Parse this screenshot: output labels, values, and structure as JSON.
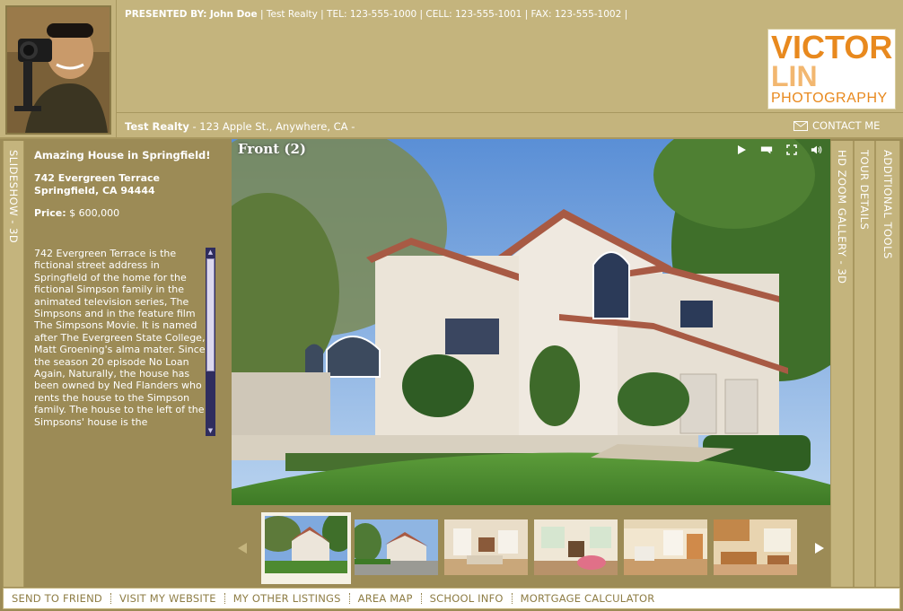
{
  "header": {
    "presented_label": "PRESENTED BY:",
    "agent_name": "John Doe",
    "contact_rest": "| Test Realty | TEL: 123-555-1000 | CELL: 123-555-1001 | FAX: 123-555-1002 |",
    "company": "Test Realty",
    "company_address": "- 123 Apple St., Anywhere, CA -",
    "contact_me": "CONTACT ME",
    "logo": {
      "line1": "VICTOR",
      "line2": "LIN",
      "line3": "PHOTOGRAPHY"
    }
  },
  "tabs": {
    "slideshow": "SLIDESHOW - 3D",
    "hd_zoom": "HD ZOOM GALLERY - 3D",
    "tour_details": "TOUR DETAILS",
    "additional_tools": "ADDITIONAL TOOLS"
  },
  "listing": {
    "title": "Amazing House in Springfield!",
    "street": "742 Evergreen Terrace",
    "city": "Springfield, CA 94444",
    "price_label": "Price:",
    "price_value": "$ 600,000",
    "description": "742 Evergreen Terrace is the fictional street address in Springfield of the home for the fictional Simpson family in the animated television series, The Simpsons and in the feature film The Simpsons Movie. It is named after The Evergreen State College, Matt Groening's alma mater. Since the season 20 episode No Loan Again, Naturally, the house has been owned by Ned Flanders who rents the house to the Simpson family. The house to the left of the Simpsons' house is the"
  },
  "photo": {
    "title": "Front (2)",
    "controls": [
      "play-icon",
      "caption-icon",
      "fullscreen-icon",
      "volume-icon"
    ]
  },
  "thumbnails": {
    "selected_index": 0,
    "items": [
      "front-exterior",
      "street-view",
      "living-room",
      "family-room",
      "dining-area",
      "kitchen"
    ]
  },
  "bottom_nav": [
    "SEND TO FRIEND",
    "VISIT MY WEBSITE",
    "MY OTHER LISTINGS",
    "AREA MAP",
    "SCHOOL INFO",
    "MORTGAGE CALCULATOR"
  ],
  "colors": {
    "frame": "#9c8b56",
    "header": "#c4b47d",
    "link": "#8e7d45",
    "logo_orange": "#e8891e"
  }
}
